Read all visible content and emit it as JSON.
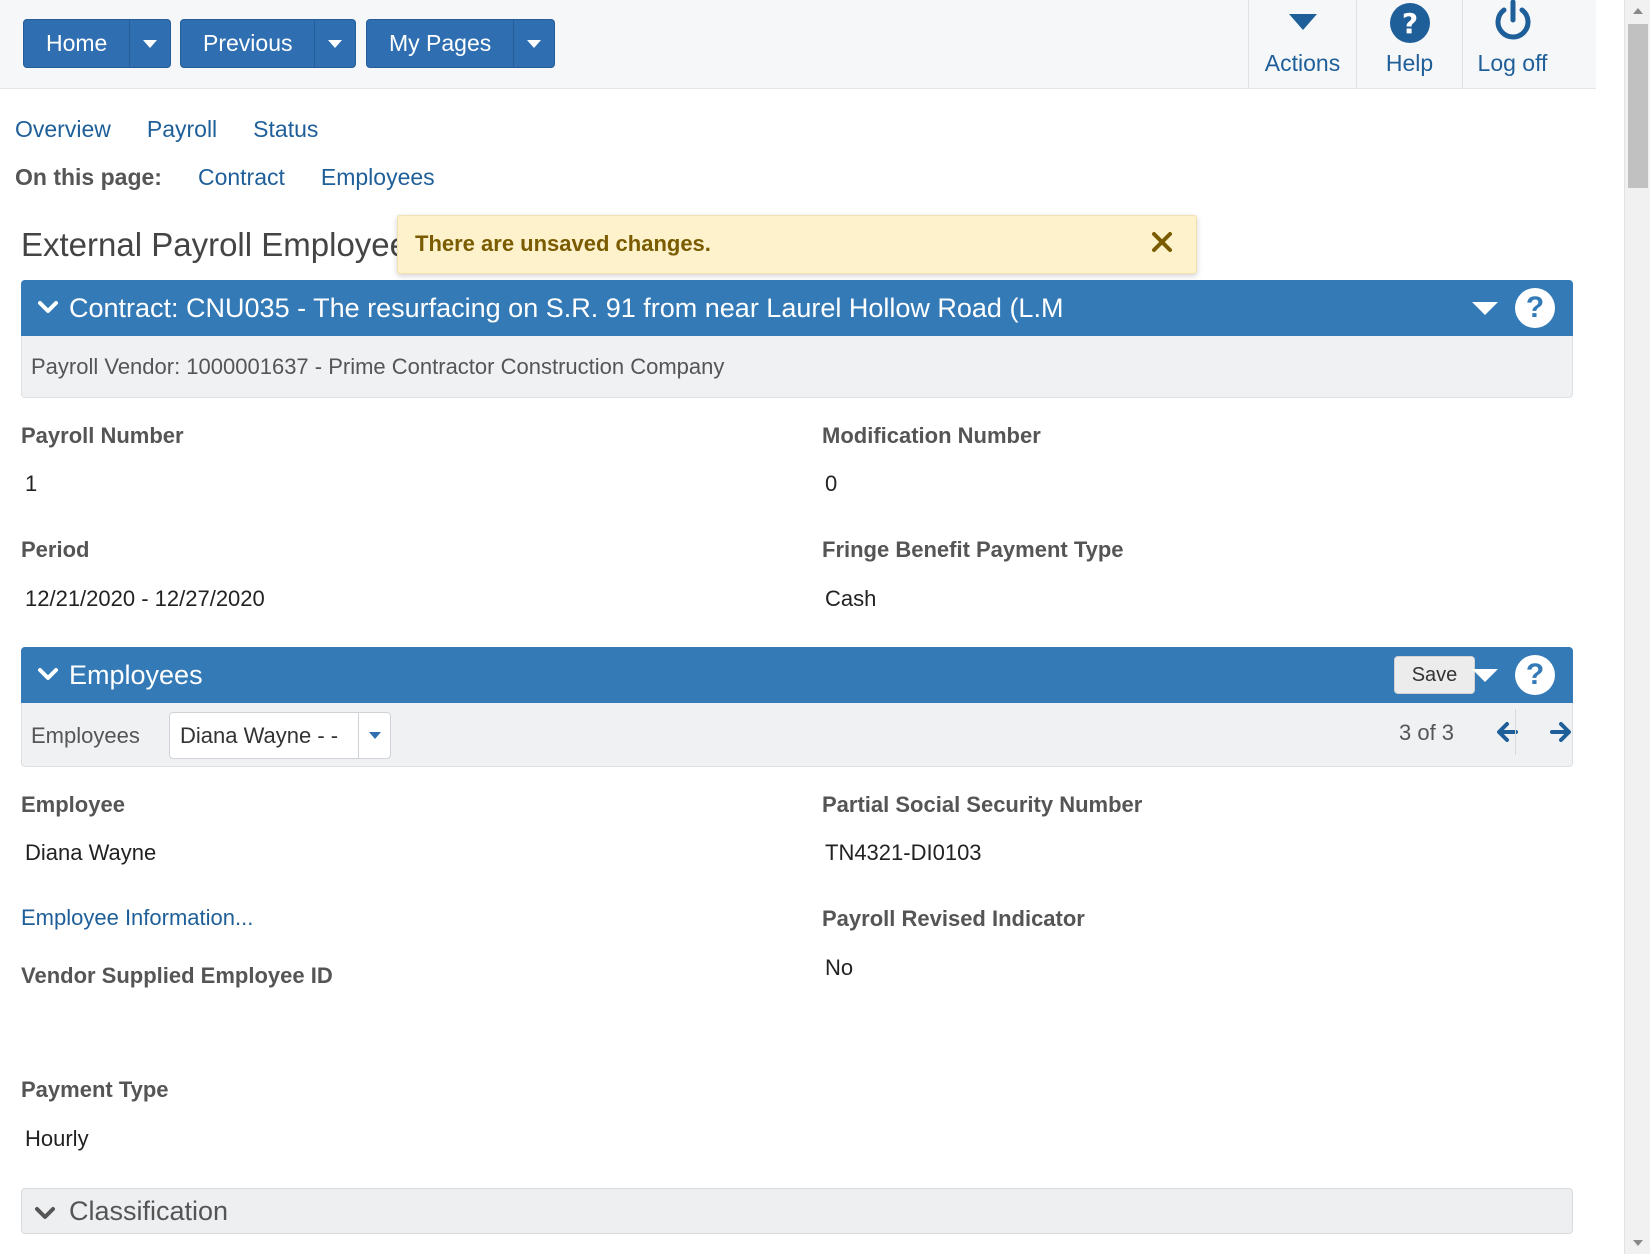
{
  "topnav": {
    "home": "Home",
    "previous": "Previous",
    "my_pages": "My Pages",
    "actions": "Actions",
    "help": "Help",
    "logoff": "Log off"
  },
  "tabs": [
    "Overview",
    "Payroll",
    "Status"
  ],
  "on_this_page": {
    "label": "On this page:",
    "links": [
      "Contract",
      "Employees"
    ]
  },
  "page_title": "External Payroll Employee",
  "toast": {
    "message": "There are unsaved changes."
  },
  "contract_panel": {
    "title": "Contract: CNU035 - The resurfacing on S.R. 91 from near Laurel Hollow Road (L.M",
    "vendor": "Payroll Vendor: 1000001637 - Prime Contractor Construction Company"
  },
  "payroll_fields": {
    "payroll_number_label": "Payroll Number",
    "payroll_number": "1",
    "modification_number_label": "Modification Number",
    "modification_number": "0",
    "period_label": "Period",
    "period": "12/21/2020 - 12/27/2020",
    "fringe_label": "Fringe Benefit Payment Type",
    "fringe": "Cash"
  },
  "employees_panel": {
    "title": "Employees",
    "save_label": "Save",
    "selector_label": "Employees",
    "selected": "Diana Wayne - -",
    "pager": "3 of 3"
  },
  "employee_fields": {
    "employee_label": "Employee",
    "employee": "Diana Wayne",
    "ssn_label": "Partial Social Security Number",
    "ssn": "TN4321-DI0103",
    "info_link": "Employee Information...",
    "revised_label": "Payroll Revised Indicator",
    "revised": "No",
    "vendor_id_label": "Vendor Supplied Employee ID",
    "payment_type_label": "Payment Type",
    "payment_type": "Hourly"
  },
  "classification": {
    "title": "Classification"
  },
  "colors": {
    "primary": "#337ab7",
    "link": "#1f5f99",
    "toast_bg": "#fdf2cc"
  }
}
